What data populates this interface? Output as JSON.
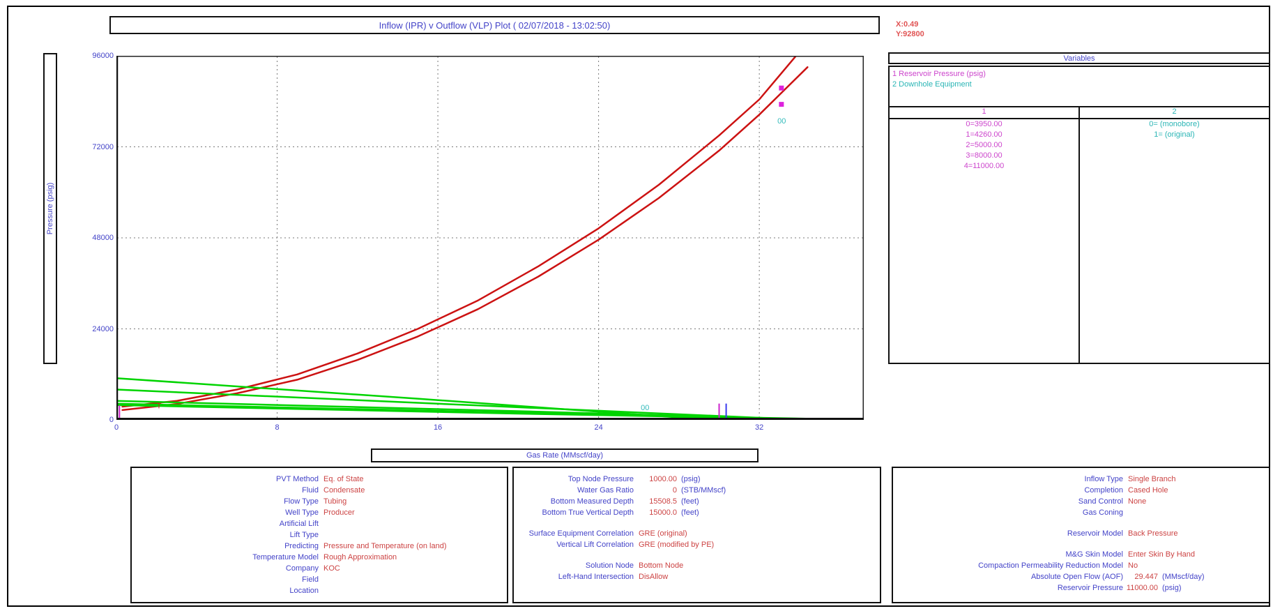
{
  "title": "Inflow (IPR) v Outflow (VLP) Plot ( 02/07/2018 - 13:02:50)",
  "crosshair": {
    "x": "X:0.49",
    "y": "Y:92800"
  },
  "chart_data": {
    "type": "line",
    "title": "Inflow (IPR) v Outflow (VLP) Plot ( 02/07/2018 - 13:02:50)",
    "xlabel": "Gas Rate  (MMscf/day)",
    "ylabel": "Pressure  (psig)",
    "xlim": [
      0,
      37.2
    ],
    "ylim": [
      0,
      96000
    ],
    "xticks": [
      0,
      8,
      16,
      24,
      32
    ],
    "yticks": [
      0,
      24000,
      48000,
      72000,
      96000
    ],
    "grid": true,
    "legend_position": "none",
    "series": [
      {
        "name": "VLP Downhole Equipment 0= (monobore)",
        "color": "#cc1212",
        "width": 2.5,
        "x": [
          0.3,
          3,
          6,
          9,
          12,
          15,
          18,
          21,
          24,
          27,
          30,
          32,
          33.8
        ],
        "y": [
          3500,
          5000,
          8000,
          12000,
          17500,
          24000,
          31500,
          40500,
          50500,
          62000,
          75000,
          84500,
          95800
        ]
      },
      {
        "name": "VLP Downhole Equipment 1= (original)",
        "color": "#cc1212",
        "width": 2.5,
        "x": [
          0.3,
          3,
          6,
          9,
          12,
          15,
          18,
          21,
          24,
          27,
          30,
          32,
          34.4
        ],
        "y": [
          2600,
          4200,
          7000,
          10600,
          15800,
          22000,
          29200,
          37800,
          47500,
          58500,
          71000,
          80500,
          93000
        ]
      },
      {
        "name": "IPR Reservoir Pressure 4=11000.00",
        "color": "#00d400",
        "width": 2.5,
        "x": [
          0,
          15,
          29.447
        ],
        "y": [
          11000,
          5600,
          100
        ]
      },
      {
        "name": "IPR Reservoir Pressure 3=8000.00",
        "color": "#00d400",
        "width": 2.5,
        "x": [
          0,
          18,
          34
        ],
        "y": [
          8000,
          3800,
          100
        ]
      },
      {
        "name": "IPR Reservoir Pressure 2=5000.00",
        "color": "#00d400",
        "width": 2.5,
        "x": [
          0,
          20,
          35
        ],
        "y": [
          5000,
          2300,
          80
        ]
      },
      {
        "name": "IPR Reservoir Pressure 1=4260.00",
        "color": "#00d400",
        "width": 2.5,
        "x": [
          0,
          20,
          35.6
        ],
        "y": [
          4260,
          1900,
          60
        ]
      },
      {
        "name": "IPR Reservoir Pressure 0=3950.00",
        "color": "#00d400",
        "width": 3,
        "x": [
          0,
          20,
          36.6
        ],
        "y": [
          3950,
          1700,
          50
        ]
      }
    ],
    "annotations": [
      {
        "type": "marker",
        "x": 33.1,
        "y": 87500,
        "color": "#dd22dd"
      },
      {
        "type": "marker",
        "x": 33.1,
        "y": 83200,
        "color": "#dd22dd"
      },
      {
        "type": "text",
        "label": "00",
        "x": 32.9,
        "y": 78200,
        "color": "#33bbbb"
      },
      {
        "type": "text",
        "label": "00",
        "x": 26.1,
        "y": 2600,
        "color": "#33bbbb"
      },
      {
        "type": "text",
        "label": "T",
        "x": 2.0,
        "y": 3000,
        "color": "#cc2222"
      },
      {
        "type": "vline",
        "x": 0.15,
        "y1": 0,
        "y2": 3800,
        "color": "#cc22cc"
      },
      {
        "type": "vline",
        "x": 30.0,
        "y1": 300,
        "y2": 4300,
        "color": "#cc22cc"
      },
      {
        "type": "vline",
        "x": 30.35,
        "y1": 300,
        "y2": 4300,
        "color": "#3a3aee"
      }
    ]
  },
  "variables_panel": {
    "title": "Variables",
    "legend": [
      {
        "label": "1 Reservoir Pressure (psig)",
        "color": "#cc44cc"
      },
      {
        "label": "2 Downhole Equipment",
        "color": "#2ab5b5"
      }
    ],
    "columns": [
      {
        "header": "1",
        "color": "#cc44cc",
        "values": [
          "0=3950.00",
          "1=4260.00",
          "2=5000.00",
          "3=8000.00",
          "4=11000.00"
        ]
      },
      {
        "header": "2",
        "color": "#2ab5b5",
        "values": [
          "0= (monobore)",
          "1= (original)"
        ]
      }
    ]
  },
  "system_panel": {
    "rows": [
      {
        "label": "PVT Method",
        "value": "Eq. of State"
      },
      {
        "label": "Fluid",
        "value": "Condensate"
      },
      {
        "label": "Flow Type",
        "value": "Tubing"
      },
      {
        "label": "Well Type",
        "value": "Producer"
      },
      {
        "label": "Artificial Lift",
        "value": ""
      },
      {
        "label": "Lift Type",
        "value": ""
      },
      {
        "label": "Predicting",
        "value": "Pressure and Temperature (on land)"
      },
      {
        "label": "Temperature Model",
        "value": "Rough Approximation"
      },
      {
        "label": "Company",
        "value": "KOC"
      },
      {
        "label": "Field",
        "value": ""
      },
      {
        "label": "Location",
        "value": ""
      }
    ]
  },
  "node_panel": {
    "rows": [
      {
        "label": "Top Node Pressure",
        "value": "1000.00",
        "unit": "(psig)"
      },
      {
        "label": "Water Gas Ratio",
        "value": "0",
        "unit": "(STB/MMscf)"
      },
      {
        "label": "Bottom Measured Depth",
        "value": "15508.5",
        "unit": "(feet)"
      },
      {
        "label": "Bottom True Vertical Depth",
        "value": "15000.0",
        "unit": "(feet)"
      },
      {
        "label": "Surface Equipment Correlation",
        "value": "GRE (original)",
        "gap": true
      },
      {
        "label": "Vertical Lift Correlation",
        "value": "GRE (modified by PE)"
      },
      {
        "label": "Solution Node",
        "value": "Bottom Node",
        "gap": true
      },
      {
        "label": "Left-Hand Intersection",
        "value": "DisAllow"
      }
    ]
  },
  "inflow_panel": {
    "rows": [
      {
        "label": "Inflow Type",
        "value": "Single Branch"
      },
      {
        "label": "Completion",
        "value": "Cased Hole"
      },
      {
        "label": "Sand Control",
        "value": "None"
      },
      {
        "label": "Gas Coning",
        "value": ""
      },
      {
        "label": "Reservoir Model",
        "value": "Back Pressure",
        "gap": true
      },
      {
        "label": "M&G Skin Model",
        "value": "Enter Skin By Hand",
        "gap": true
      },
      {
        "label": "Compaction Permeability Reduction Model",
        "value": "No"
      },
      {
        "label": "Absolute Open Flow (AOF)",
        "value": "29.447",
        "unit": "(MMscf/day)"
      },
      {
        "label": "Reservoir Pressure",
        "value": "11000.00",
        "unit": "(psig)"
      }
    ]
  }
}
